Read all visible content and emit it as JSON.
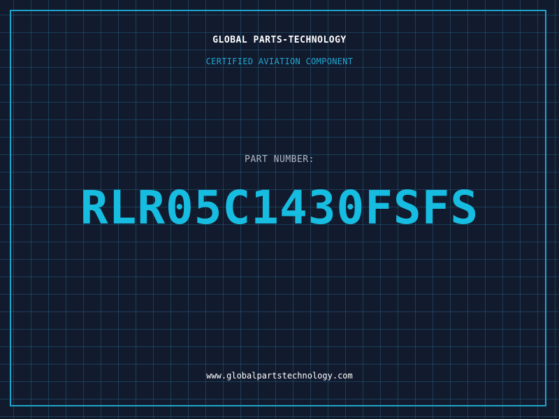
{
  "header": {
    "company": "GLOBAL PARTS-TECHNOLOGY",
    "subtitle": "CERTIFIED AVIATION COMPONENT"
  },
  "part": {
    "label": "PART NUMBER:",
    "number": "RLR05C1430FSFS"
  },
  "footer": {
    "website": "www.globalpartstechnology.com"
  },
  "colors": {
    "background": "#121a2e",
    "grid": "#287896",
    "accent": "#16bde0",
    "frame": "#1ba6c9"
  }
}
